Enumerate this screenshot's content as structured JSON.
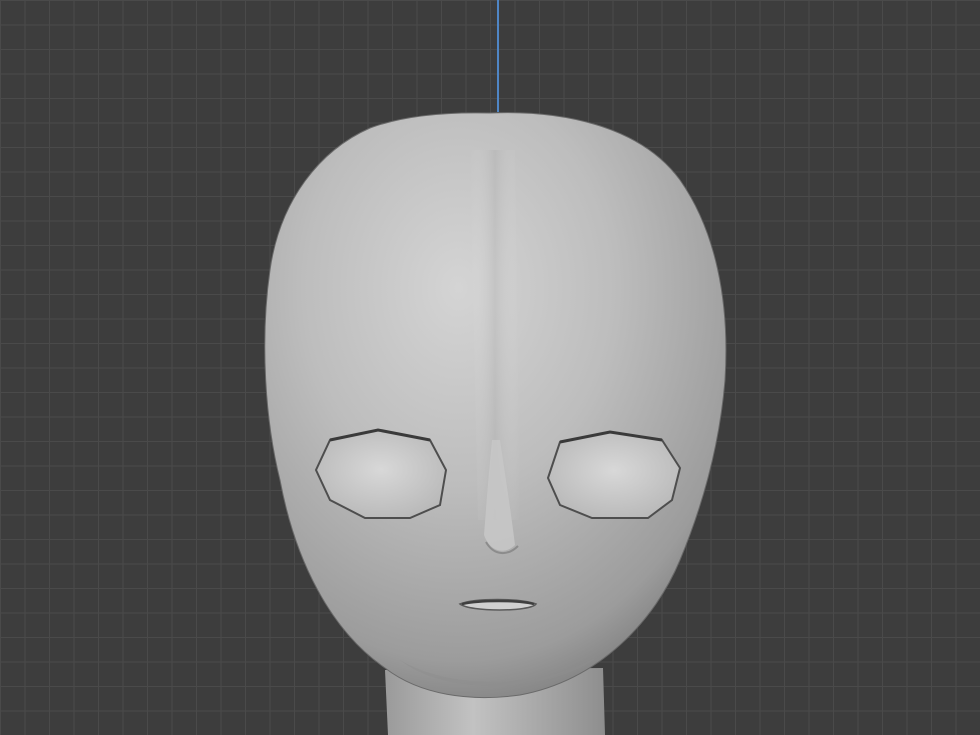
{
  "viewport": {
    "background_color": "#3d3d3d",
    "grid_line_color": "#4a4a4a",
    "axis_z_color": "#4f86c6",
    "object": {
      "name_icon": "head-mesh-icon",
      "base_color": "#b4b4b4",
      "highlight_color": "#d2d2d2",
      "shadow_color": "#8a8a8a"
    }
  }
}
